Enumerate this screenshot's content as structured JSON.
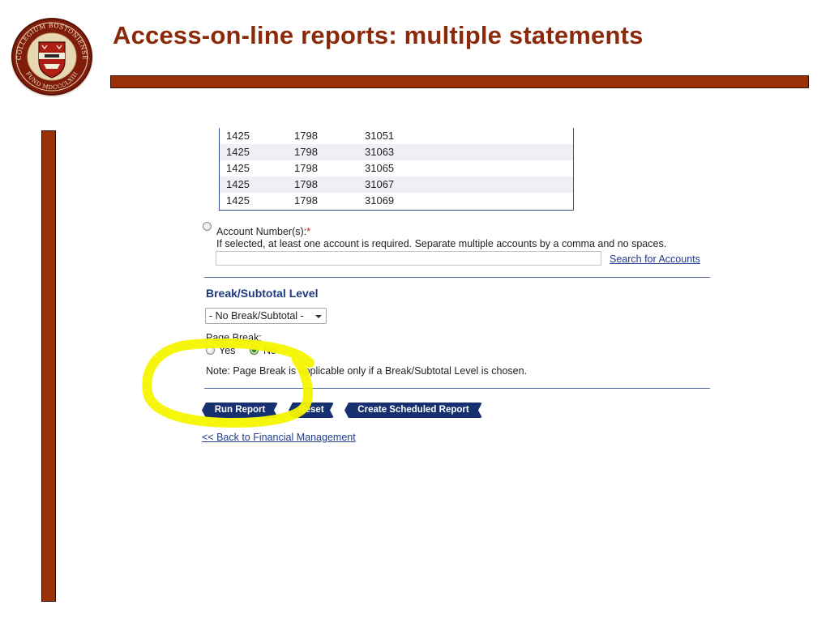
{
  "slide": {
    "title": "Access-on-line reports: multiple statements",
    "seal_text": "COLLEGIUM BOSTONIENSE FUND MDCCCLXIII",
    "brand_color": "#9a3008",
    "title_color": "#8b2a0a"
  },
  "table": {
    "rows": [
      [
        "1425",
        "1798",
        "31051"
      ],
      [
        "1425",
        "1798",
        "31063"
      ],
      [
        "1425",
        "1798",
        "31065"
      ],
      [
        "1425",
        "1798",
        "31067"
      ],
      [
        "1425",
        "1798",
        "31069"
      ]
    ]
  },
  "account": {
    "label": "Account Number(s):",
    "required_mark": "*",
    "help": "If selected, at least one account is required. Separate multiple accounts by a comma and no spaces.",
    "input_value": "",
    "search_link": "Search for Accounts"
  },
  "break": {
    "heading": "Break/Subtotal Level",
    "selected": "- No Break/Subtotal -",
    "page_break_label": "Page Break:",
    "yes": "Yes",
    "no": "No",
    "selected_option": "No",
    "note": "Note: Page Break is applicable only if a Break/Subtotal Level is chosen."
  },
  "buttons": {
    "run": "Run Report",
    "reset": "Reset",
    "scheduled": "Create Scheduled Report"
  },
  "back_link": "<< Back to Financial Management",
  "annotation": {
    "highlight_color": "#f5f500"
  }
}
